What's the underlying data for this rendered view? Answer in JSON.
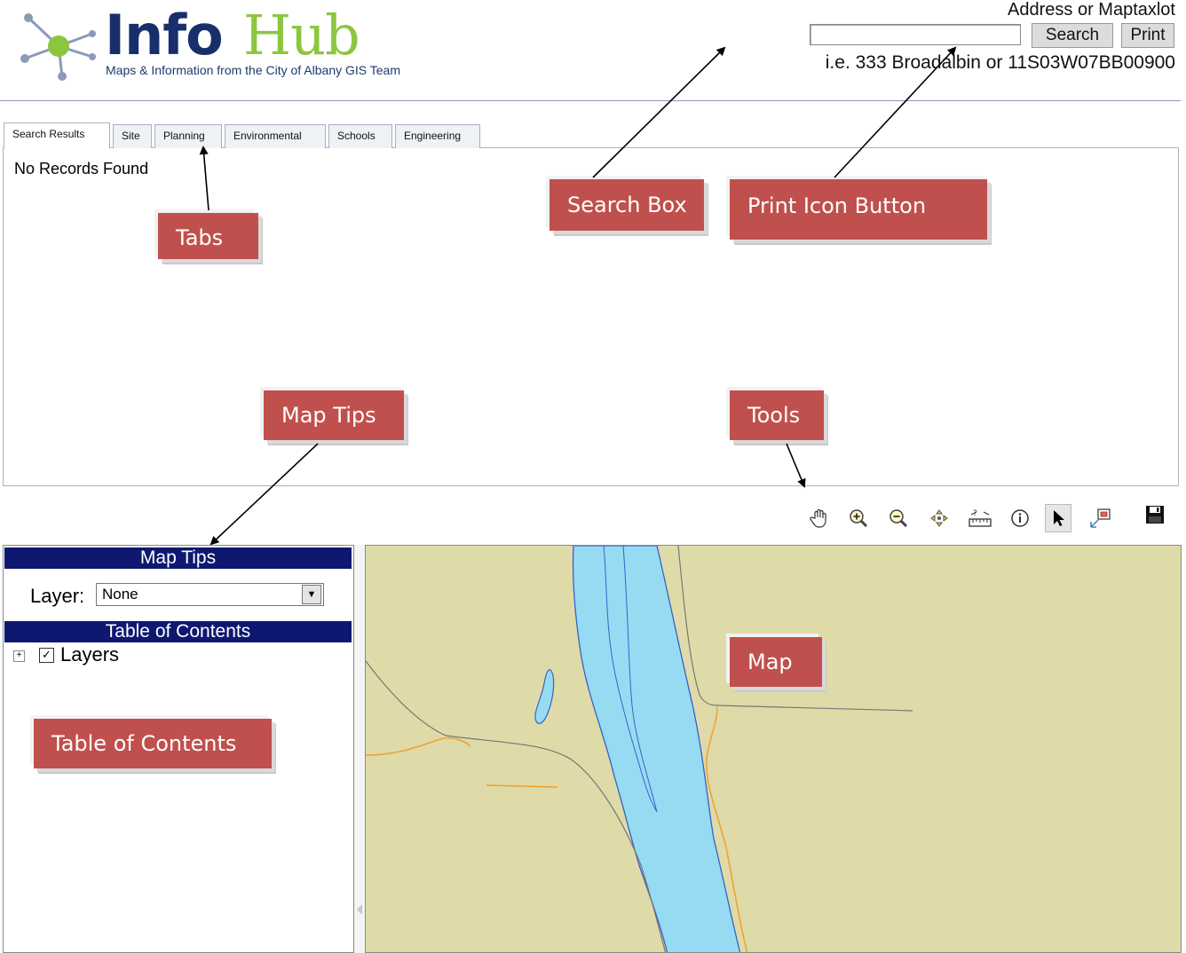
{
  "header": {
    "logo_info": "Info",
    "logo_hub": "Hub",
    "tagline": "Maps & Information from the City of Albany GIS Team",
    "search_title": "Address or Maptaxlot",
    "search_value": "",
    "search_button": "Search",
    "print_button": "Print",
    "search_hint": "i.e. 333 Broadalbin or 11S03W07BB00900"
  },
  "tabs": [
    {
      "label": "Search Results",
      "active": true
    },
    {
      "label": "Site"
    },
    {
      "label": "Planning"
    },
    {
      "label": "Environmental"
    },
    {
      "label": "Schools"
    },
    {
      "label": "Engineering"
    }
  ],
  "results": {
    "message": "No Records Found"
  },
  "toolbar": {
    "tools": [
      "pan-hand",
      "zoom-in",
      "zoom-out",
      "full-extent",
      "measure",
      "identify",
      "select-arrow",
      "overview-map",
      "save"
    ]
  },
  "map_tips": {
    "header": "Map Tips",
    "layer_label": "Layer:",
    "layer_value": "None"
  },
  "toc": {
    "header": "Table of Contents",
    "root_label": "Layers",
    "root_checked": true
  },
  "callouts": {
    "search_box": "Search Box",
    "print_icon": "Print Icon Button",
    "tabs": "Tabs",
    "map_tips": "Map Tips",
    "tools": "Tools",
    "map": "Map",
    "toc": "Table of Contents"
  },
  "colors": {
    "callout": "#c0504d",
    "panel_header": "#0e1870",
    "map_land": "#dedba8",
    "map_water": "#97dbf2",
    "logo_navy": "#17306b",
    "logo_green": "#8cc63f"
  }
}
